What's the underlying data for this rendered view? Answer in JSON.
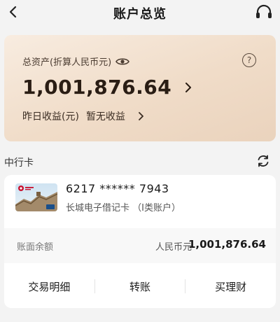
{
  "header": {
    "title": "账户总览",
    "back_icon": "chevron-left-icon",
    "service_icon": "headset-icon"
  },
  "assets": {
    "label": "总资产(折算人民币元)",
    "amount": "1,001,876.64",
    "yield_label": "昨日收益(元)",
    "yield_value": "暂无收益",
    "eye_icon": "eye-icon",
    "help_icon": "question-icon",
    "help_symbol": "?"
  },
  "section": {
    "title": "中行卡",
    "refresh_icon": "refresh-icon"
  },
  "card": {
    "number": "6217 ****** 7943",
    "type": "长城电子借记卡 （I类账户）",
    "balance_label": "账面余额",
    "currency": "人民币元",
    "balance": "1,001,876.64"
  },
  "actions": [
    {
      "label": "交易明细"
    },
    {
      "label": "转账"
    },
    {
      "label": "买理财"
    }
  ],
  "colors": {
    "card_gradient_start": "#f8ece0",
    "card_gradient_end": "#ead3bd",
    "bank_red": "#c8102e"
  }
}
